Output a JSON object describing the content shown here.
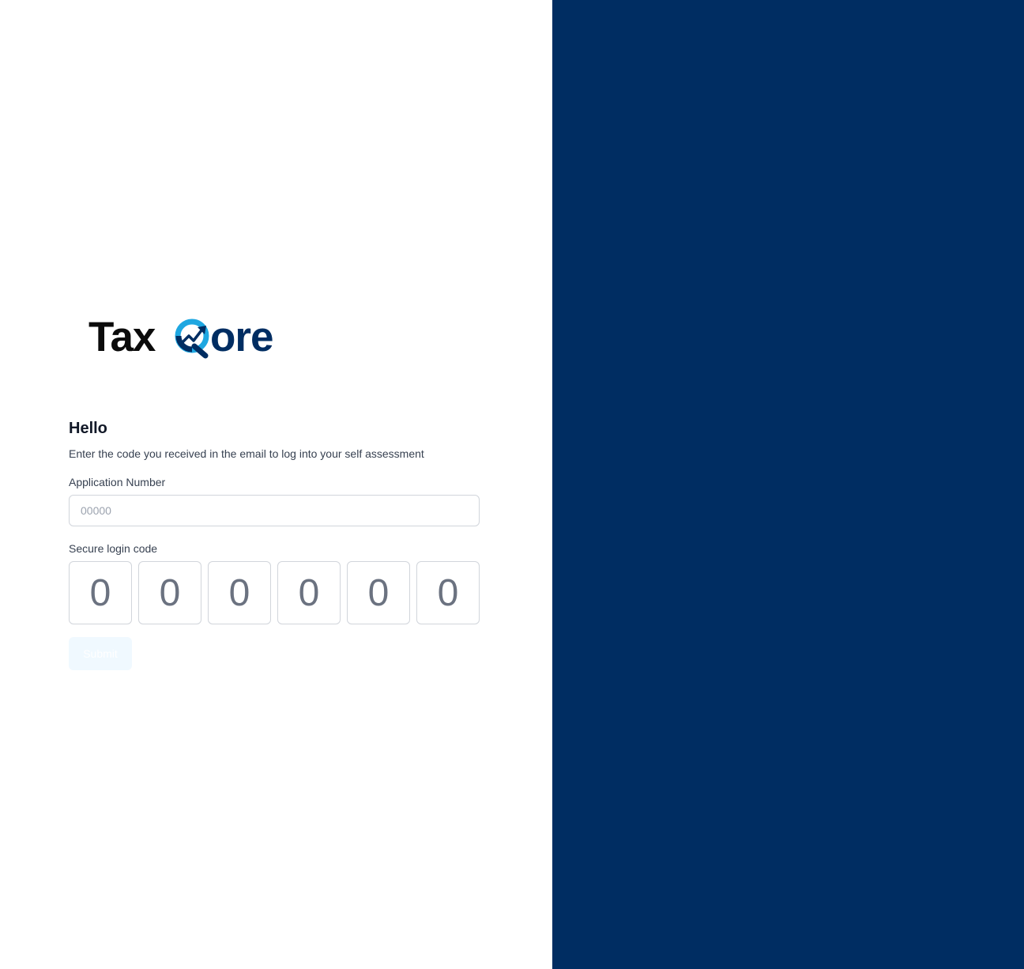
{
  "brand": {
    "logo_text": "TaxQore",
    "logo_dark_part": "Tax",
    "logo_light_part": "ore",
    "colors": {
      "dark_text": "#0b0b0b",
      "navy": "#002d62",
      "cyan": "#1ea7e1"
    }
  },
  "form": {
    "heading": "Hello",
    "subtitle": "Enter the code you received in the email to log into your self assessment",
    "application_label": "Application Number",
    "application_placeholder": "00000",
    "code_label": "Secure login code",
    "code_placeholders": [
      "0",
      "0",
      "0",
      "0",
      "0",
      "0"
    ],
    "submit_label": "Submit"
  },
  "colors": {
    "right_panel": "#002d62",
    "submit_bg": "#f0f9ff"
  }
}
